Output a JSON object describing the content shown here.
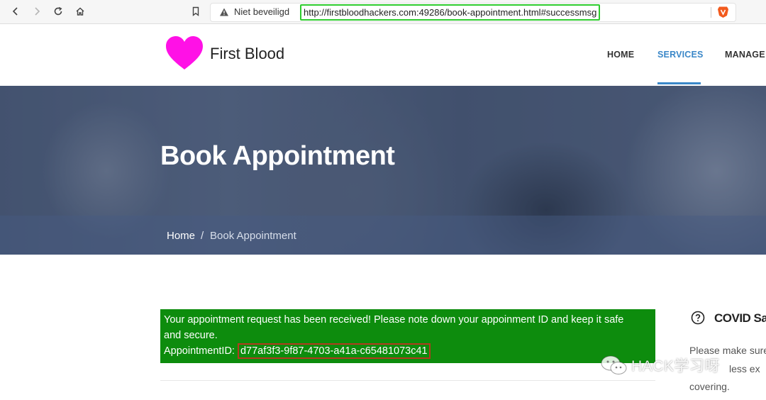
{
  "browser": {
    "security_label": "Niet beveiligd",
    "url": "http://firstbloodhackers.com:49286/book-appointment.html#successmsg",
    "nav_icons": [
      "back-icon",
      "forward-icon",
      "reload-icon",
      "home-icon",
      "bookmark-icon",
      "warning-icon",
      "brave-icon"
    ]
  },
  "site": {
    "brand": "First Blood",
    "logo_color": "#ff11e6",
    "menu": [
      {
        "label": "HOME",
        "active": false
      },
      {
        "label": "SERVICES",
        "active": true
      },
      {
        "label": "MANAGE A",
        "active": false
      }
    ],
    "accent_color": "#3a87c8"
  },
  "hero": {
    "title": "Book Appointment",
    "breadcrumb": {
      "home": "Home",
      "separator": "/",
      "current": "Book Appointment"
    }
  },
  "success": {
    "line1": "Your appointment request has been received! Please note down your appoinment ID and keep it safe",
    "line2": "and secure.",
    "id_label": "AppointmentID: ",
    "id_value": "d77af3f3-9f87-4703-a41a-c65481073c41",
    "bg_color": "#0d8c0d"
  },
  "sidebar": {
    "title": "COVID Sa",
    "text_lines": [
      "Please make sure",
      "less ex",
      "covering."
    ]
  },
  "watermark": {
    "text": "HACK学习呀"
  }
}
